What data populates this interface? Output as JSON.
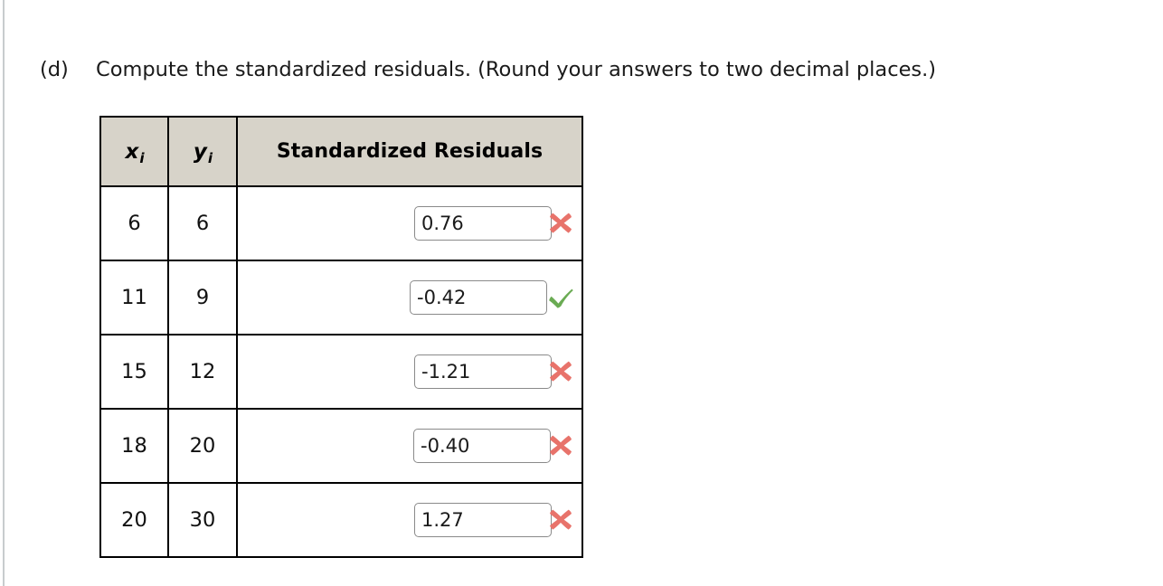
{
  "question": {
    "label": "(d)",
    "text": "Compute the standardized residuals. (Round your answers to two decimal places.)"
  },
  "table": {
    "headers": {
      "x": "x",
      "x_sub": "i",
      "y": "y",
      "y_sub": "i",
      "residuals": "Standardized Residuals"
    },
    "rows": [
      {
        "x": "6",
        "y": "6",
        "answer": "0.76",
        "status": "incorrect",
        "status_icon": "red-x-icon",
        "placeholder": ""
      },
      {
        "x": "11",
        "y": "9",
        "answer": "-0.42",
        "status": "correct",
        "status_icon": "green-check-icon",
        "placeholder": ""
      },
      {
        "x": "15",
        "y": "12",
        "answer": "-1.21",
        "status": "incorrect",
        "status_icon": "red-x-icon",
        "placeholder": ""
      },
      {
        "x": "18",
        "y": "20",
        "answer": "-0.40",
        "status": "incorrect",
        "status_icon": "red-x-icon",
        "placeholder": ""
      },
      {
        "x": "20",
        "y": "30",
        "answer": "1.27",
        "status": "incorrect",
        "status_icon": "red-x-icon",
        "placeholder": ""
      }
    ]
  },
  "colors": {
    "header_background": "#d7d3c9",
    "incorrect": "#e8736b",
    "correct": "#6aab53",
    "border": "#000000",
    "input_border": "#8a8a8a",
    "page_rule": "#c8ccce"
  }
}
